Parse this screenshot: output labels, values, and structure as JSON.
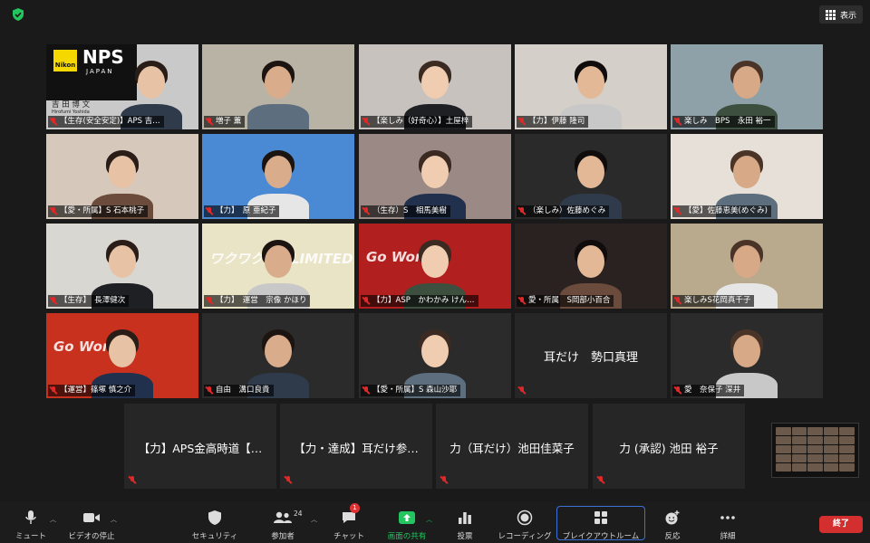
{
  "app": {
    "view_label": "表示"
  },
  "grid": {
    "tiles": [
      {
        "label": "【生存(安全安定)】APS 吉…",
        "bg": "#c9c9c9",
        "logo_text": "NPS",
        "logo_sub": "JAPAN",
        "brand": "Nikon",
        "nameplate": "吉 田 博 文",
        "nameplate_sub": "Hirofumi Yoshida"
      },
      {
        "label": "増子 薫",
        "bg": "#b9b3a6"
      },
      {
        "label": "【楽しみ（好奇心）】土屋梓",
        "bg": "#c7c2bd"
      },
      {
        "label": "【力】伊藤 隆司",
        "bg": "#d4cfc9"
      },
      {
        "label": "楽しみ　BPS　永田 裕一",
        "bg": "#8ea0a8",
        "active": true
      },
      {
        "label": "【愛・所属】S 石本桃子",
        "bg": "#d7c8bc"
      },
      {
        "label": "【力】　原 亜紀子",
        "bg": "#4a8ad4"
      },
      {
        "label": "（生存）S　相馬美樹",
        "bg": "#9a8984"
      },
      {
        "label": "（楽しみ）佐藤めぐみ",
        "bg": "#2a2a2a"
      },
      {
        "label": "【愛】佐藤恵美(めぐみ)",
        "bg": "#e6e0d8"
      },
      {
        "label": "【生存】　長澤健次",
        "bg": "#d9d7d2"
      },
      {
        "label": "【力】　運営　宗像 かほり",
        "bg": "#e9e4c6",
        "banner": "ワクワク UNLIMITED"
      },
      {
        "label": "【力】ASP　かわかみ けん…",
        "bg": "#b21f1f",
        "banner": "Go World"
      },
      {
        "label": "愛・所属　S岡部小百合",
        "bg": "#2a2220"
      },
      {
        "label": "楽しみS花岡真千子",
        "bg": "#b9a98d"
      },
      {
        "label": "【運営】篠塚 慎之介",
        "bg": "#c7311e",
        "banner": "Go World"
      },
      {
        "label": "自由　溝口良貴",
        "bg": "#2b2b2b"
      },
      {
        "label": "【愛・所属】S 森山沙耶",
        "bg": "#2b2b2b"
      },
      {
        "label": "",
        "center": "耳だけ　勢口真理",
        "bg": "#262626"
      },
      {
        "label": "愛　奈保子 深井",
        "bg": "#2b2b2b"
      }
    ],
    "name_tiles": [
      "【力】APS金高時道【…",
      "【力・達成】耳だけ参…",
      "力（耳だけ）池田佳菜子",
      "力 (承認)  池田 裕子"
    ]
  },
  "toolbar": {
    "mute": "ミュート",
    "video": "ビデオの停止",
    "security": "セキュリティ",
    "participants": "参加者",
    "participants_count": "24",
    "chat": "チャット",
    "chat_badge": "1",
    "share": "画面の共有",
    "polls": "投票",
    "record": "レコーディング",
    "breakout": "ブレイクアウトルーム",
    "reactions": "反応",
    "more": "詳細",
    "end": "終了"
  },
  "colors": {
    "accent_green": "#22c55e",
    "active_outline": "#d2e07a",
    "end_red": "#d32f2f",
    "breakout_outline": "#3a72d8"
  }
}
